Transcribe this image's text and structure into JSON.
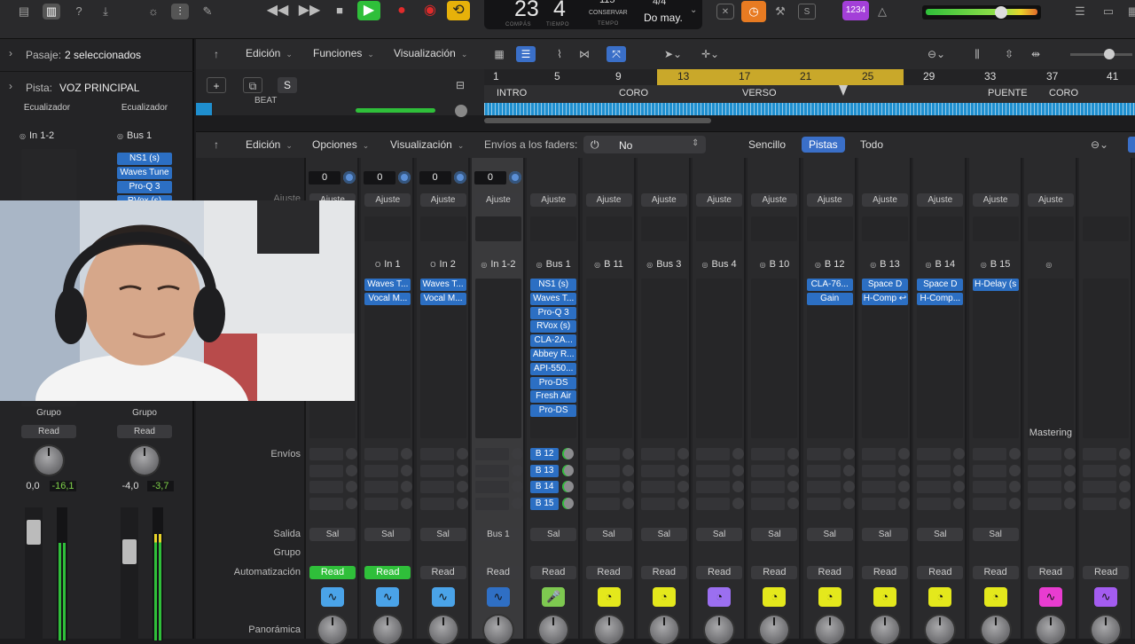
{
  "transport": {
    "bars": "23",
    "beats": "4",
    "bars_label": "COMPÁS",
    "beats_label": "TIEMPO",
    "tempo": "115",
    "tempo_mode": "CONSERVAR",
    "tempo_label": "TEMPO",
    "signature": "4/4",
    "key": "Do may.",
    "user_badge": "1234"
  },
  "inspector": {
    "region_key": "Pasaje:",
    "region_value": "2 seleccionados",
    "track_key": "Pista:",
    "track_value": "VOZ PRINCIPAL",
    "eq_left": "Ecualizador",
    "eq_right": "Ecualizador",
    "input_left": "In 1-2",
    "input_right": "Bus 1",
    "plugins_right": [
      "NS1 (s)",
      "Waves Tune",
      "Pro-Q 3",
      "RVox (s)"
    ],
    "group_left": "Grupo",
    "group_right": "Grupo",
    "read_left": "Read",
    "read_right": "Read",
    "vol_left": "0,0",
    "peak_left": "-16,1",
    "vol_right": "-4,0",
    "peak_right": "-3,7"
  },
  "tracks_bar": {
    "edit": "Edición",
    "functions": "Funciones",
    "view": "Visualización",
    "add": "+",
    "solo_s": "S"
  },
  "ruler": {
    "bars": [
      "1",
      "5",
      "9",
      "13",
      "17",
      "21",
      "25",
      "29",
      "33",
      "37",
      "41"
    ],
    "markers": [
      "INTRO",
      "CORO",
      "VERSO",
      "PUENTE",
      "CORO"
    ],
    "track_name": "BEAT"
  },
  "mixer_bar": {
    "edit": "Edición",
    "options": "Opciones",
    "view": "Visualización",
    "sends_label": "Envíos a los faders:",
    "sends_value": "No",
    "seg_single": "Sencillo",
    "seg_tracks": "Pistas",
    "seg_all": "Todo"
  },
  "mixer_labels": {
    "sends": "Envíos",
    "output": "Salida",
    "group": "Grupo",
    "automation": "Automatización",
    "pan": "Panorámica",
    "setting_partial": "Ajuste"
  },
  "channels": [
    {
      "vol": "0",
      "setting": "Ajuste",
      "input": "",
      "io": "",
      "plugins": [],
      "sends": [],
      "output": "Sal",
      "read": "Read",
      "read_active": true,
      "icon_color": "#4aa3e8",
      "icon": "∿",
      "label": ""
    },
    {
      "vol": "0",
      "setting": "Ajuste",
      "input": "In 1",
      "io": "O",
      "plugins": [
        "Waves T...",
        "Vocal M..."
      ],
      "sends": [],
      "output": "Sal",
      "read": "Read",
      "read_active": true,
      "icon_color": "#4aa3e8",
      "icon": "∿",
      "label": ""
    },
    {
      "vol": "0",
      "setting": "Ajuste",
      "input": "In 2",
      "io": "O",
      "plugins": [
        "Waves T...",
        "Vocal M..."
      ],
      "sends": [],
      "output": "Sal",
      "read": "Read",
      "read_active": false,
      "icon_color": "#4aa3e8",
      "icon": "∿",
      "label": ""
    },
    {
      "vol": "0",
      "setting": "Ajuste",
      "input": "In 1-2",
      "io": "◎",
      "plugins": [],
      "sends": [],
      "output": "Bus 1",
      "read": "Read",
      "read_active": false,
      "icon_color": "#2f6fc4",
      "icon": "∿",
      "label": ""
    },
    {
      "vol": "",
      "setting": "Ajuste",
      "input": "Bus 1",
      "io": "◎",
      "plugins": [
        "NS1 (s)",
        "Waves T...",
        "Pro-Q 3",
        "RVox (s)",
        "CLA-2A...",
        "Abbey R...",
        "API-550...",
        "Pro-DS",
        "Fresh Air",
        "Pro-DS"
      ],
      "sends": [
        "B 12",
        "B 13",
        "B 14",
        "B 15"
      ],
      "output": "Sal",
      "read": "Read",
      "read_active": false,
      "icon_color": "#7ec850",
      "icon": "🎤",
      "label": ""
    },
    {
      "vol": "",
      "setting": "Ajuste",
      "input": "B 11",
      "io": "◎",
      "plugins": [],
      "sends": [],
      "output": "Sal",
      "read": "Read",
      "read_active": false,
      "icon_color": "#e4e81c",
      "icon": "◔",
      "label": ""
    },
    {
      "vol": "",
      "setting": "Ajuste",
      "input": "Bus 3",
      "io": "◎",
      "plugins": [],
      "sends": [],
      "output": "Sal",
      "read": "Read",
      "read_active": false,
      "icon_color": "#e4e81c",
      "icon": "◔",
      "label": ""
    },
    {
      "vol": "",
      "setting": "Ajuste",
      "input": "Bus 4",
      "io": "◎",
      "plugins": [],
      "sends": [],
      "output": "Sal",
      "read": "Read",
      "read_active": false,
      "icon_color": "#9b6ff0",
      "icon": "◔",
      "label": ""
    },
    {
      "vol": "",
      "setting": "Ajuste",
      "input": "B 10",
      "io": "◎",
      "plugins": [],
      "sends": [],
      "output": "Sal",
      "read": "Read",
      "read_active": false,
      "icon_color": "#e4e81c",
      "icon": "◔",
      "label": ""
    },
    {
      "vol": "",
      "setting": "Ajuste",
      "input": "B 12",
      "io": "◎",
      "plugins": [
        "CLA-76...",
        "Gain"
      ],
      "sends": [],
      "output": "Sal",
      "read": "Read",
      "read_active": false,
      "icon_color": "#e4e81c",
      "icon": "◔",
      "label": ""
    },
    {
      "vol": "",
      "setting": "Ajuste",
      "input": "B 13",
      "io": "◎",
      "plugins": [
        "Space D",
        "H-Comp ↩"
      ],
      "sends": [],
      "output": "Sal",
      "read": "Read",
      "read_active": false,
      "icon_color": "#e4e81c",
      "icon": "◔",
      "label": ""
    },
    {
      "vol": "",
      "setting": "Ajuste",
      "input": "B 14",
      "io": "◎",
      "plugins": [
        "Space D",
        "H-Comp..."
      ],
      "sends": [],
      "output": "Sal",
      "read": "Read",
      "read_active": false,
      "icon_color": "#e4e81c",
      "icon": "◔",
      "label": ""
    },
    {
      "vol": "",
      "setting": "Ajuste",
      "input": "B 15",
      "io": "◎",
      "plugins": [
        "H-Delay (s"
      ],
      "sends": [],
      "output": "Sal",
      "read": "Read",
      "read_active": false,
      "icon_color": "#e4e81c",
      "icon": "◔",
      "label": ""
    },
    {
      "vol": "",
      "setting": "Ajuste",
      "input": "",
      "io": "◎",
      "plugins": [],
      "sends": [],
      "output": "",
      "read": "Read",
      "read_active": false,
      "icon_color": "#e83cd0",
      "icon": "∿",
      "label": "Mastering"
    },
    {
      "vol": "",
      "setting": "",
      "input": "",
      "io": "",
      "plugins": [],
      "sends": [],
      "output": "",
      "read": "Read",
      "read_active": false,
      "icon_color": "#a35cf0",
      "icon": "∿",
      "label": ""
    }
  ],
  "colors": {
    "accent_blue": "#2c6fc3",
    "read_green": "#2fbf3a",
    "cycle_yellow": "#e7b10a",
    "ruler_yellow": "#c9a82a",
    "wave_blue": "#1f8fcf"
  }
}
